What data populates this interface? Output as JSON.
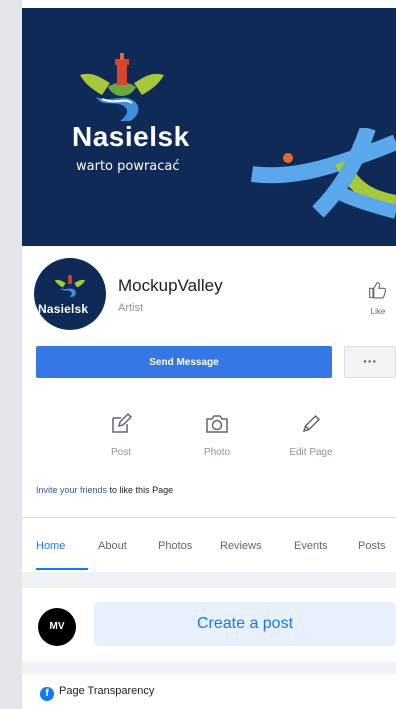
{
  "cover": {
    "title": "Nasielsk",
    "tagline": "warto powracać"
  },
  "profile": {
    "avatar_text": "Nasielsk",
    "name": "MockupValley",
    "category": "Artist"
  },
  "like_label": "Like",
  "send_message_label": "Send Message",
  "more_label": "···",
  "actions": [
    {
      "label": "Post",
      "icon": "edit-icon"
    },
    {
      "label": "Photo",
      "icon": "camera-icon"
    },
    {
      "label": "Edit Page",
      "icon": "pencil-icon"
    }
  ],
  "invite": {
    "link": "Invite your friends",
    "rest": " to like this Page"
  },
  "tabs": [
    "Home",
    "About",
    "Photos",
    "Reviews",
    "Events",
    "Posts"
  ],
  "active_tab": "Home",
  "composer": {
    "avatar_text": "MV",
    "placeholder": "Create a post"
  },
  "transparency_label": "Page Transparency",
  "colors": {
    "cover_bg": "#0f2a57",
    "accent": "#3578e5",
    "link": "#1877f2"
  }
}
